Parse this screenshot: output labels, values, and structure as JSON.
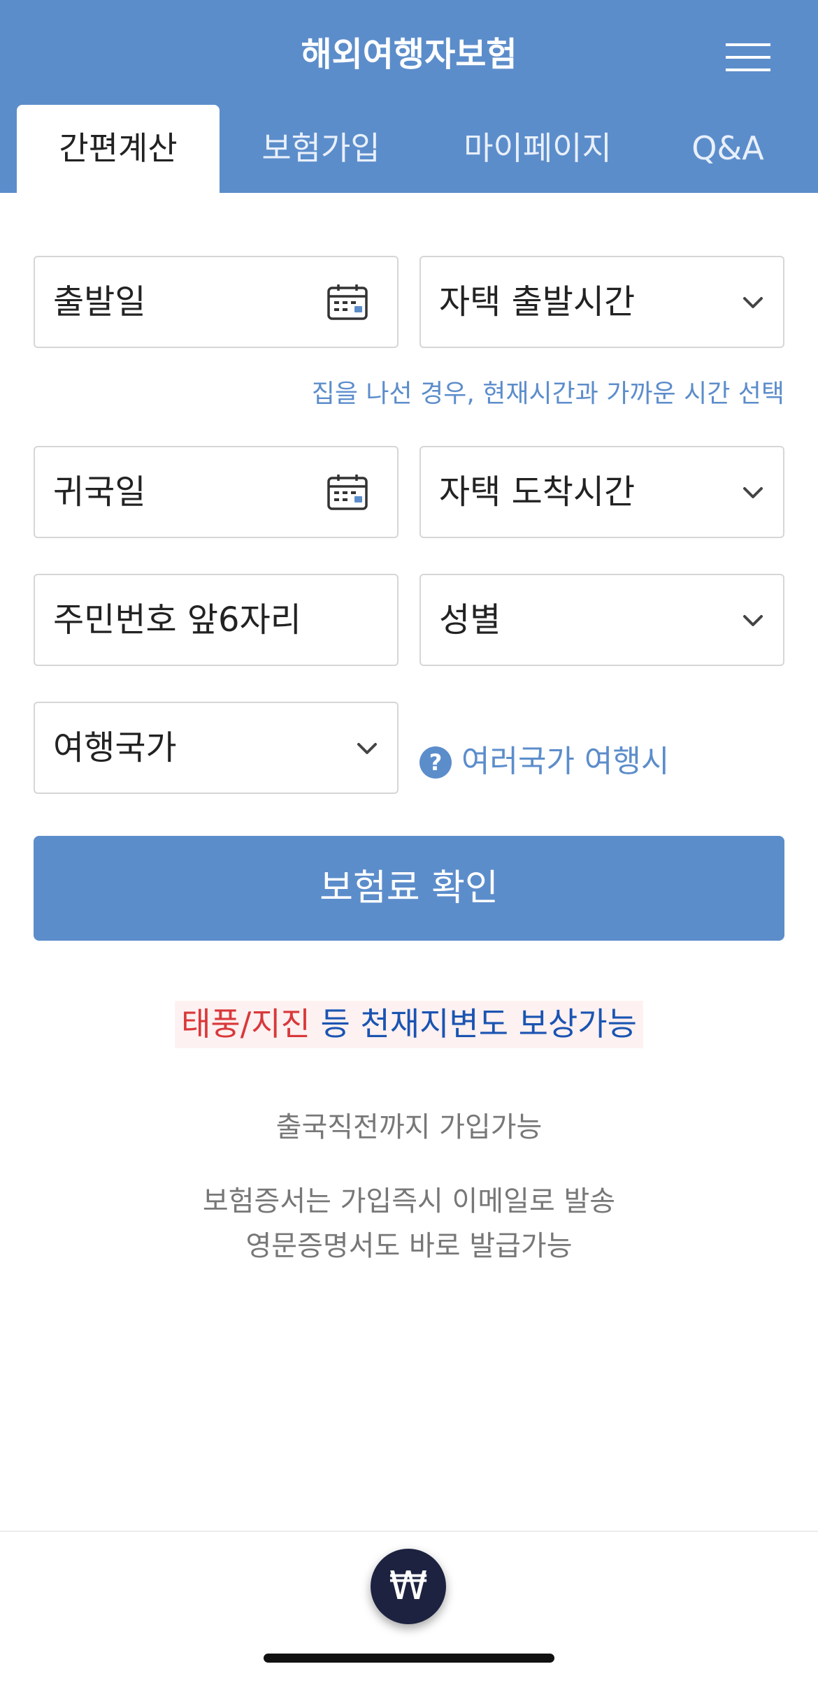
{
  "header": {
    "title": "해외여행자보험",
    "tabs": [
      {
        "label": "간편계산",
        "active": true
      },
      {
        "label": "보험가입",
        "active": false
      },
      {
        "label": "마이페이지",
        "active": false
      },
      {
        "label": "Q&A",
        "active": false
      }
    ]
  },
  "form": {
    "departure_date": "출발일",
    "departure_time": "자택 출발시간",
    "departure_hint": "집을 나선 경우, 현재시간과 가까운 시간 선택",
    "return_date": "귀국일",
    "arrival_time": "자택 도착시간",
    "resident_number": "주민번호 앞6자리",
    "gender": "성별",
    "country": "여행국가",
    "multi_country_icon": "?",
    "multi_country_link": "여러국가 여행시"
  },
  "cta": {
    "label": "보험료 확인"
  },
  "promo": {
    "highlight": "태풍/지진",
    "text": " 등 천재지변도 보상가능"
  },
  "info": {
    "line1": "출국직전까지 가입가능",
    "line2": "보험증서는 가입즉시 이메일로 발송",
    "line3": "영문증명서도 바로 발급가능"
  },
  "bottom": {
    "won_symbol": "₩"
  },
  "colors": {
    "primary": "#5c8dcb",
    "promo_red": "#d9383a",
    "promo_blue": "#1a54b2",
    "fab": "#1c2240"
  }
}
